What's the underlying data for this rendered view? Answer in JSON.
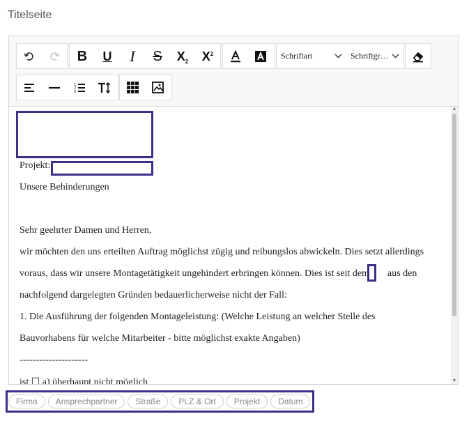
{
  "section": {
    "title": "Titelseite"
  },
  "toolbar": {
    "undo_icon": "undo-icon",
    "redo_icon": "redo-icon",
    "bold": "B",
    "underline": "U",
    "italic": "I",
    "strike": "S",
    "subscript": "X",
    "subscript_mark": "2",
    "superscript": "X",
    "superscript_mark": "2",
    "font_select": "Schriftart",
    "size_select": "Schriftgr…"
  },
  "document": {
    "lines": [
      "Projekt:",
      "Unsere Behinderungen",
      "Sehr geehrter Damen und Herren,",
      "wir möchten den uns erteilten Auftrag möglichst zügig und reibungslos abwickeln. Dies setzt allerdings",
      "voraus, dass wir unsere Montagetätigkeit ungehindert erbringen können. Dies ist seit dem",
      "aus den",
      "nachfolgend dargelegten Gründen bedauerlicherweise nicht der Fall:",
      "1. Die Ausführung der folgenden Montageleistung: (Welche Leistung an welcher Stelle des",
      "Bauvorhabens für welche Mitarbeiter - bitte möglichst exakte Angaben)",
      "---------------------",
      "ist ☐ a) überhaupt nicht möglich"
    ]
  },
  "placeholders": [
    "Firma",
    "Ansprechpartner",
    "Straße",
    "PLZ & Ort",
    "Projekt",
    "Datum"
  ],
  "colors": {
    "highlight": "#3f2d86"
  }
}
